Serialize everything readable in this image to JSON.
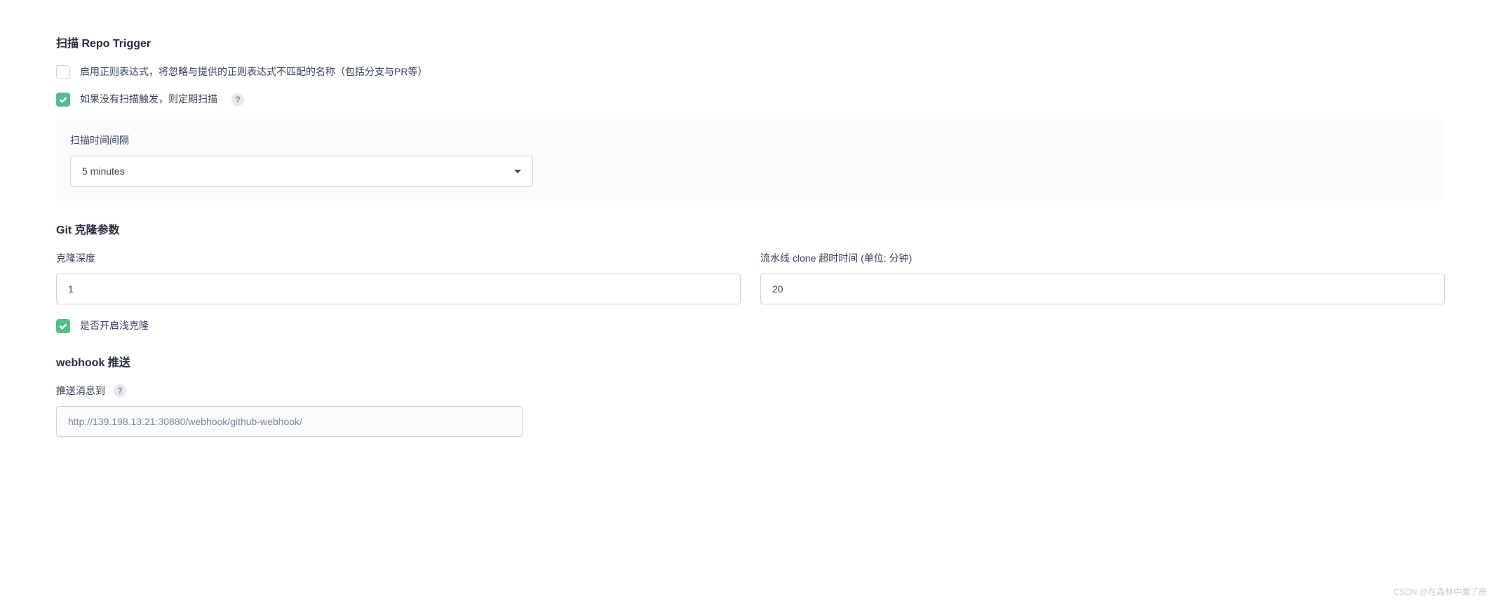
{
  "scan_trigger": {
    "title": "扫描 Repo Trigger",
    "regex_checkbox": {
      "checked": false,
      "label": "启用正则表达式，将忽略与提供的正则表达式不匹配的名称（包括分支与PR等）"
    },
    "periodic_checkbox": {
      "checked": true,
      "label": "如果没有扫描触发，则定期扫描"
    },
    "interval": {
      "label": "扫描时间间隔",
      "value": "5 minutes"
    }
  },
  "git_clone": {
    "title": "Git 克隆参数",
    "depth": {
      "label": "克隆深度",
      "value": "1"
    },
    "timeout": {
      "label": "流水线 clone 超时时间 (单位: 分钟)",
      "value": "20"
    },
    "shallow_checkbox": {
      "checked": true,
      "label": "是否开启浅克隆"
    }
  },
  "webhook": {
    "title": "webhook 推送",
    "push_to": {
      "label": "推送消息到",
      "value": "http://139.198.13.21:30880/webhook/github-webhook/"
    }
  },
  "watermark": "CSDN @在森林中麋了鹿"
}
